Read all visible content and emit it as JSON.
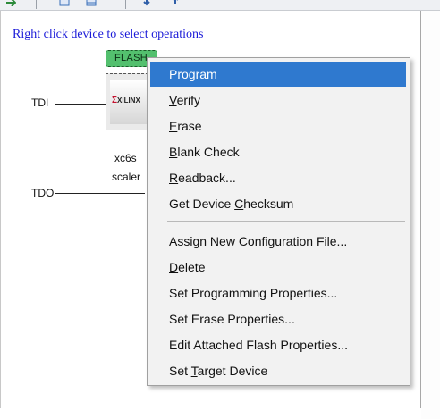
{
  "canvas": {
    "hint": "Right click device to select operations",
    "tdi_label": "TDI",
    "tdo_label": "TDO"
  },
  "device": {
    "flash_label": "FLASH",
    "vendor_logo": "XILINX",
    "part_text": "xc6s",
    "file_text": "scaler"
  },
  "context_menu": {
    "items": [
      {
        "pre": "",
        "key": "P",
        "post": "rogram"
      },
      {
        "pre": "",
        "key": "V",
        "post": "erify"
      },
      {
        "pre": "",
        "key": "E",
        "post": "rase"
      },
      {
        "pre": "",
        "key": "B",
        "post": "lank Check"
      },
      {
        "pre": "",
        "key": "R",
        "post": "eadback..."
      },
      {
        "pre": "Get Device ",
        "key": "C",
        "post": "hecksum"
      },
      {
        "pre": "",
        "key": "A",
        "post": "ssign New Configuration File..."
      },
      {
        "pre": "",
        "key": "D",
        "post": "elete"
      },
      {
        "pre": "Set Programming Properties...",
        "key": "",
        "post": ""
      },
      {
        "pre": "Set Erase Properties...",
        "key": "",
        "post": ""
      },
      {
        "pre": "Edit Attached Flash Properties...",
        "key": "",
        "post": ""
      },
      {
        "pre": "Set ",
        "key": "T",
        "post": "arget Device"
      }
    ],
    "highlight_color": "#2f79cf"
  },
  "icons": [
    "toolbar-arrow-icon",
    "toolbar-doc-icon",
    "toolbar-window-icon",
    "toolbar-down-icon",
    "toolbar-up-icon"
  ]
}
